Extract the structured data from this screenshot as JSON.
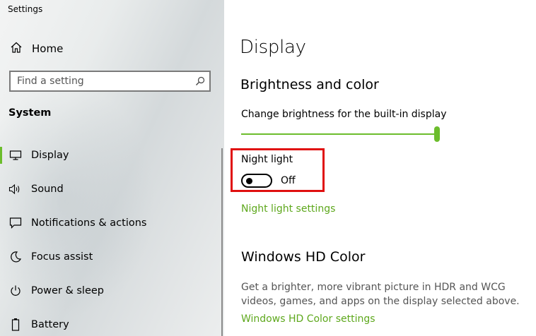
{
  "app": {
    "title": "Settings"
  },
  "sidebar": {
    "home_label": "Home",
    "search": {
      "placeholder": "Find a setting",
      "icon": "search-icon"
    },
    "section_title": "System",
    "items": [
      {
        "label": "Display",
        "icon": "monitor-icon",
        "active": true
      },
      {
        "label": "Sound",
        "icon": "speaker-icon",
        "active": false
      },
      {
        "label": "Notifications & actions",
        "icon": "message-icon",
        "active": false
      },
      {
        "label": "Focus assist",
        "icon": "moon-icon",
        "active": false
      },
      {
        "label": "Power & sleep",
        "icon": "power-icon",
        "active": false
      },
      {
        "label": "Battery",
        "icon": "battery-icon",
        "active": false
      }
    ]
  },
  "main": {
    "title": "Display",
    "brightness_section": {
      "heading": "Brightness and color",
      "brightness_label": "Change brightness for the built-in display",
      "brightness_value_fraction": 1.0
    },
    "night_light": {
      "label": "Night light",
      "state": "Off",
      "settings_link": "Night light settings"
    },
    "hd_color": {
      "heading": "Windows HD Color",
      "description": "Get a brighter, more vibrant picture in HDR and WCG videos, games, and apps on the display selected above.",
      "settings_link": "Windows HD Color settings"
    }
  },
  "colors": {
    "accent": "#6cbd2c",
    "link": "#5ea81d",
    "highlight_box": "#e01010"
  }
}
